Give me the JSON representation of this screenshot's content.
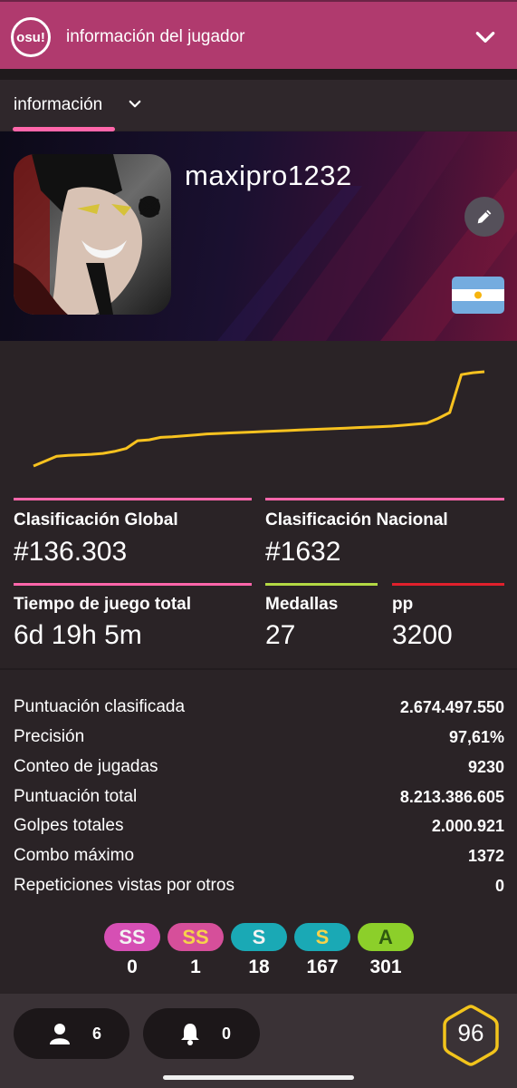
{
  "header": {
    "logo_text": "osu!",
    "title": "información del jugador",
    "chevron": "chevron-down-icon"
  },
  "subnav": {
    "tab_label": "información",
    "chevron": "chevron-down-icon"
  },
  "profile": {
    "username": "maxipro1232",
    "edit_icon": "pencil-icon",
    "flag": "argentina-flag"
  },
  "chart_data": {
    "type": "line",
    "title": "",
    "series": [
      {
        "name": "",
        "color": "#f7c21f",
        "values": [
          0,
          5,
          10,
          11,
          11.5,
          12,
          13,
          15,
          18,
          26,
          27,
          29.5,
          30,
          31,
          32,
          33,
          33.5,
          34,
          34.5,
          35,
          35.5,
          36,
          36.5,
          37,
          37.5,
          38,
          38.5,
          39,
          39.5,
          40,
          40.5,
          41,
          42,
          43,
          44,
          49,
          55,
          94,
          96,
          97
        ]
      }
    ],
    "grid": false,
    "legend": "none"
  },
  "stats": {
    "global_rank_label": "Clasificación Global",
    "global_rank_value": "#136.303",
    "national_rank_label": "Clasificación Nacional",
    "national_rank_value": "#1632",
    "playtime_label": "Tiempo de juego total",
    "playtime_value": "6d 19h 5m",
    "medals_label": "Medallas",
    "medals_value": "27",
    "pp_label": "pp",
    "pp_value": "3200",
    "colors": {
      "pink": "#ff66aa",
      "green": "#b3d944",
      "red": "#e0202c"
    }
  },
  "details": [
    {
      "label": "Puntuación clasificada",
      "value": "2.674.497.550"
    },
    {
      "label": "Precisión",
      "value": "97,61%"
    },
    {
      "label": "Conteo de jugadas",
      "value": "9230"
    },
    {
      "label": "Puntuación total",
      "value": "8.213.386.605"
    },
    {
      "label": "Golpes totales",
      "value": "2.000.921"
    },
    {
      "label": "Combo máximo",
      "value": "1372"
    },
    {
      "label": "Repeticiones vistas por otros",
      "value": "0"
    }
  ],
  "grades": [
    {
      "letter": "SS",
      "count": "0",
      "bg": "#d64fb4",
      "fg": "#f3f3f3"
    },
    {
      "letter": "SS",
      "count": "1",
      "bg": "#d64f9a",
      "fg": "#f7d24b"
    },
    {
      "letter": "S",
      "count": "18",
      "bg": "#1aa9b5",
      "fg": "#f3f3f3"
    },
    {
      "letter": "S",
      "count": "167",
      "bg": "#1aa9b5",
      "fg": "#f7d24b"
    },
    {
      "letter": "A",
      "count": "301",
      "bg": "#8ccf2a",
      "fg": "#2f5a10"
    }
  ],
  "footer": {
    "friends_icon": "user-icon",
    "friends_count": "6",
    "notifications_icon": "bell-icon",
    "notifications_count": "0",
    "level": "96",
    "level_color": "#f2c41c"
  }
}
